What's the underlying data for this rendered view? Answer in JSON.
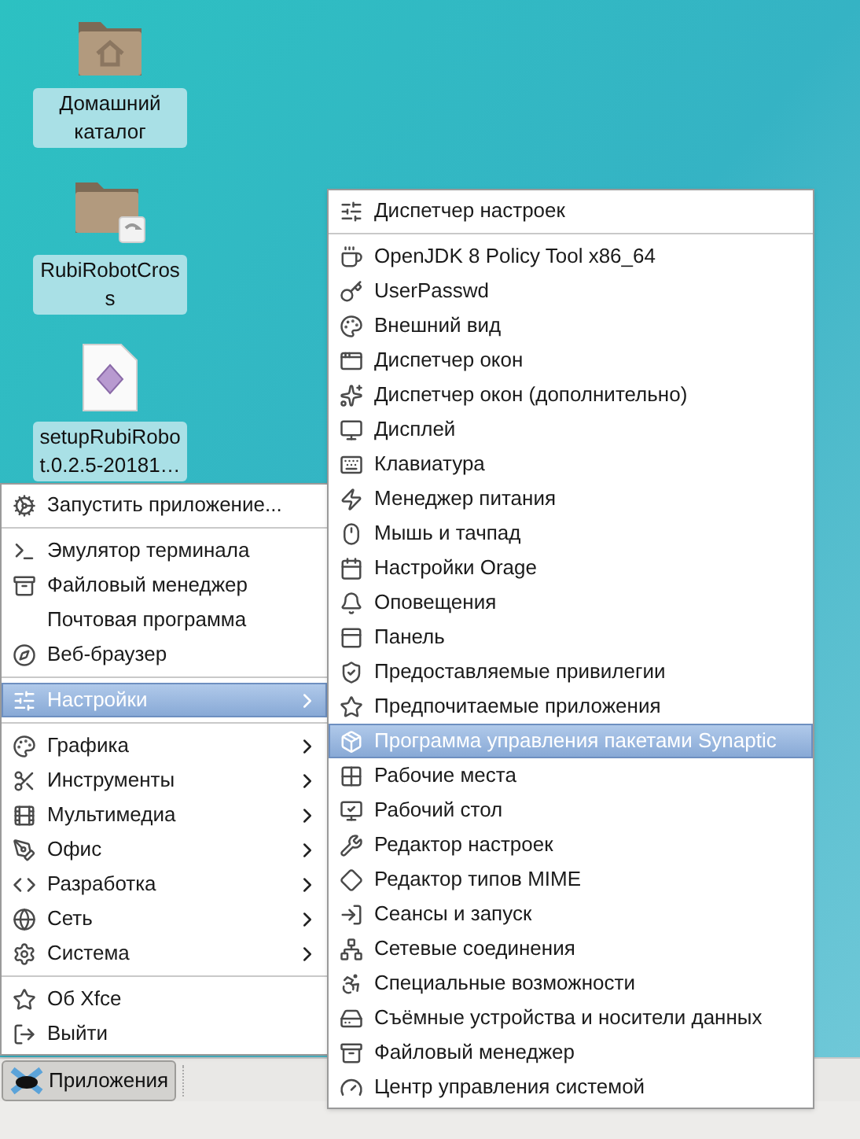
{
  "desktop_icons": [
    {
      "kind": "home-folder",
      "label": "Домашний каталог"
    },
    {
      "kind": "link-folder",
      "label": "RubiRobotCros s"
    },
    {
      "kind": "file",
      "label": "setupRubiRobot.0.2.5-20181…"
    }
  ],
  "main_menu": {
    "sections": [
      {
        "items": [
          {
            "label": "Запустить приложение...",
            "selected": false,
            "submenu": false
          }
        ]
      },
      {
        "items": [
          {
            "label": "Эмулятор терминала",
            "selected": false,
            "submenu": false
          },
          {
            "label": "Файловый менеджер",
            "selected": false,
            "submenu": false
          },
          {
            "label": "Почтовая программа",
            "selected": false,
            "submenu": false
          },
          {
            "label": "Веб-браузер",
            "selected": false,
            "submenu": false
          }
        ]
      },
      {
        "items": [
          {
            "label": "Настройки",
            "selected": true,
            "submenu": true
          }
        ]
      },
      {
        "items": [
          {
            "label": "Графика",
            "selected": false,
            "submenu": true
          },
          {
            "label": "Инструменты",
            "selected": false,
            "submenu": true
          },
          {
            "label": "Мультимедиа",
            "selected": false,
            "submenu": true
          },
          {
            "label": "Офис",
            "selected": false,
            "submenu": true
          },
          {
            "label": "Разработка",
            "selected": false,
            "submenu": true
          },
          {
            "label": "Сеть",
            "selected": false,
            "submenu": true
          },
          {
            "label": "Система",
            "selected": false,
            "submenu": true
          }
        ]
      },
      {
        "items": [
          {
            "label": "Об Xfce",
            "selected": false,
            "submenu": false
          },
          {
            "label": "Выйти",
            "selected": false,
            "submenu": false
          }
        ]
      }
    ]
  },
  "submenu": {
    "sections": [
      {
        "items": [
          {
            "label": "Диспетчер настроек",
            "selected": false
          }
        ]
      },
      {
        "items": [
          {
            "label": "OpenJDK 8 Policy Tool x86_64",
            "selected": false
          },
          {
            "label": "UserPasswd",
            "selected": false
          },
          {
            "label": "Внешний вид",
            "selected": false
          },
          {
            "label": "Диспетчер окон",
            "selected": false
          },
          {
            "label": "Диспетчер окон (дополнительно)",
            "selected": false
          },
          {
            "label": "Дисплей",
            "selected": false
          },
          {
            "label": "Клавиатура",
            "selected": false
          },
          {
            "label": "Менеджер питания",
            "selected": false
          },
          {
            "label": "Мышь и тачпад",
            "selected": false
          },
          {
            "label": "Настройки Orage",
            "selected": false
          },
          {
            "label": "Оповещения",
            "selected": false
          },
          {
            "label": "Панель",
            "selected": false
          },
          {
            "label": "Предоставляемые привилегии",
            "selected": false
          },
          {
            "label": "Предпочитаемые приложения",
            "selected": false
          },
          {
            "label": "Программа управления пакетами Synaptic",
            "selected": true
          },
          {
            "label": "Рабочие места",
            "selected": false
          },
          {
            "label": "Рабочий стол",
            "selected": false
          },
          {
            "label": "Редактор настроек",
            "selected": false
          },
          {
            "label": "Редактор типов MIME",
            "selected": false
          },
          {
            "label": "Сеансы и запуск",
            "selected": false
          },
          {
            "label": "Сетевые соединения",
            "selected": false
          },
          {
            "label": "Специальные возможности",
            "selected": false
          },
          {
            "label": "Съёмные устройства и носители данных",
            "selected": false
          },
          {
            "label": "Файловый менеджер",
            "selected": false
          },
          {
            "label": "Центр управления системой",
            "selected": false
          }
        ]
      }
    ]
  },
  "taskbar": {
    "button": "Приложения"
  }
}
